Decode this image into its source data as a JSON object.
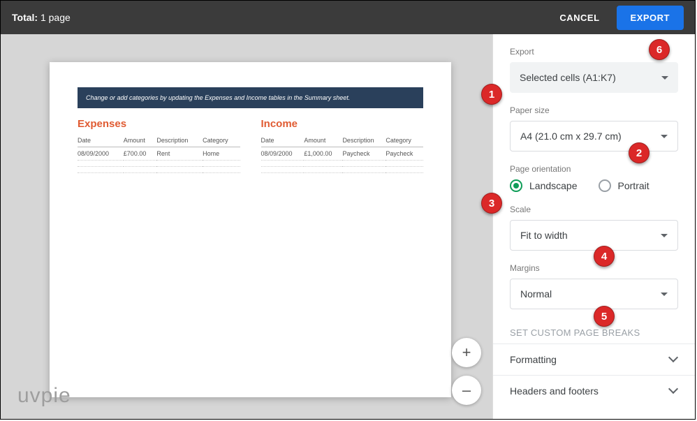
{
  "topbar": {
    "total_label": "Total:",
    "total_value": "1 page",
    "cancel": "CANCEL",
    "export": "EXPORT"
  },
  "preview": {
    "banner": "Change or add categories by updating the Expenses and Income tables in the Summary sheet.",
    "expenses": {
      "title": "Expenses",
      "headers": [
        "Date",
        "Amount",
        "Description",
        "Category"
      ],
      "row": [
        "08/09/2000",
        "£700.00",
        "Rent",
        "Home"
      ]
    },
    "income": {
      "title": "Income",
      "headers": [
        "Date",
        "Amount",
        "Description",
        "Category"
      ],
      "row": [
        "08/09/2000",
        "£1,000.00",
        "Paycheck",
        "Paycheck"
      ]
    }
  },
  "sidebar": {
    "export": {
      "label": "Export",
      "value": "Selected cells (A1:K7)"
    },
    "paper": {
      "label": "Paper size",
      "value": "A4 (21.0 cm x 29.7 cm)"
    },
    "orientation": {
      "label": "Page orientation",
      "landscape": "Landscape",
      "portrait": "Portrait"
    },
    "scale": {
      "label": "Scale",
      "value": "Fit to width"
    },
    "margins": {
      "label": "Margins",
      "value": "Normal"
    },
    "pagebreaks": "SET CUSTOM PAGE BREAKS",
    "formatting": "Formatting",
    "headers_footers": "Headers and footers"
  },
  "zoom": {
    "in": "+",
    "out": "–"
  },
  "watermark": "uvpie",
  "callouts": {
    "1": "1",
    "2": "2",
    "3": "3",
    "4": "4",
    "5": "5",
    "6": "6"
  }
}
